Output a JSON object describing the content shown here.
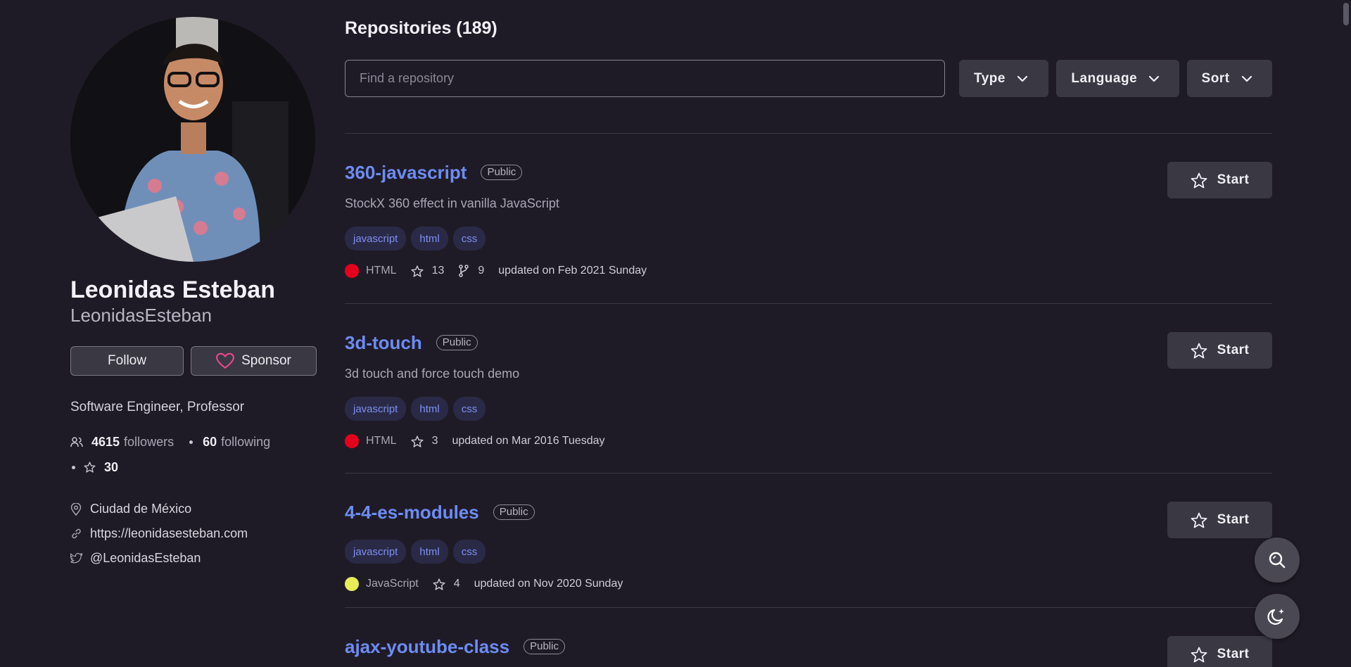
{
  "profile": {
    "name": "Leonidas Esteban",
    "login": "LeonidasEsteban",
    "follow_label": "Follow",
    "sponsor_label": "Sponsor",
    "bio": "Software Engineer, Professor",
    "followers_count": "4615",
    "followers_label": "followers",
    "following_count": "60",
    "following_label": "following",
    "stars_count": "30",
    "location": "Ciudad de México",
    "website": "https://leonidasesteban.com",
    "twitter": "@LeonidasEsteban"
  },
  "main": {
    "title": "Repositories (189)",
    "search_placeholder": "Find a repository",
    "filters": {
      "type": "Type",
      "language": "Language",
      "sort": "Sort"
    }
  },
  "repos": [
    {
      "name": "360-javascript",
      "visibility": "Public",
      "description": "StockX 360 effect in vanilla JavaScript",
      "topics": [
        "javascript",
        "html",
        "css"
      ],
      "language": "HTML",
      "language_color": "#e5001d",
      "stars": "13",
      "forks": "9",
      "updated": "updated on Feb 2021 Sunday",
      "star_label": "Start"
    },
    {
      "name": "3d-touch",
      "visibility": "Public",
      "description": "3d touch and force touch demo",
      "topics": [
        "javascript",
        "html",
        "css"
      ],
      "language": "HTML",
      "language_color": "#e5001d",
      "stars": "3",
      "updated": "updated on Mar 2016 Tuesday",
      "star_label": "Start"
    },
    {
      "name": "4-4-es-modules",
      "visibility": "Public",
      "topics": [
        "javascript",
        "html",
        "css"
      ],
      "language": "JavaScript",
      "language_color": "#e8ec57",
      "stars": "4",
      "updated": "updated on Nov 2020 Sunday",
      "star_label": "Start"
    },
    {
      "name": "ajax-youtube-class",
      "visibility": "Public",
      "star_label": "Start"
    }
  ],
  "icons": {
    "people": "people-icon",
    "star": "star-icon",
    "location": "location-pin-icon",
    "link": "link-icon",
    "twitter": "twitter-icon",
    "heart": "heart-icon",
    "fork": "fork-icon",
    "chevron": "chevron-down-icon",
    "search_fab": "search-zoom-icon",
    "theme": "moon-sparkle-icon"
  },
  "colors": {
    "background": "#1f1b26",
    "link": "#6d8cf3",
    "topic_bg": "#2a2a47",
    "topic_text": "#7d8ff0",
    "button_bg": "#3a3842",
    "heart": "#e8468e"
  }
}
